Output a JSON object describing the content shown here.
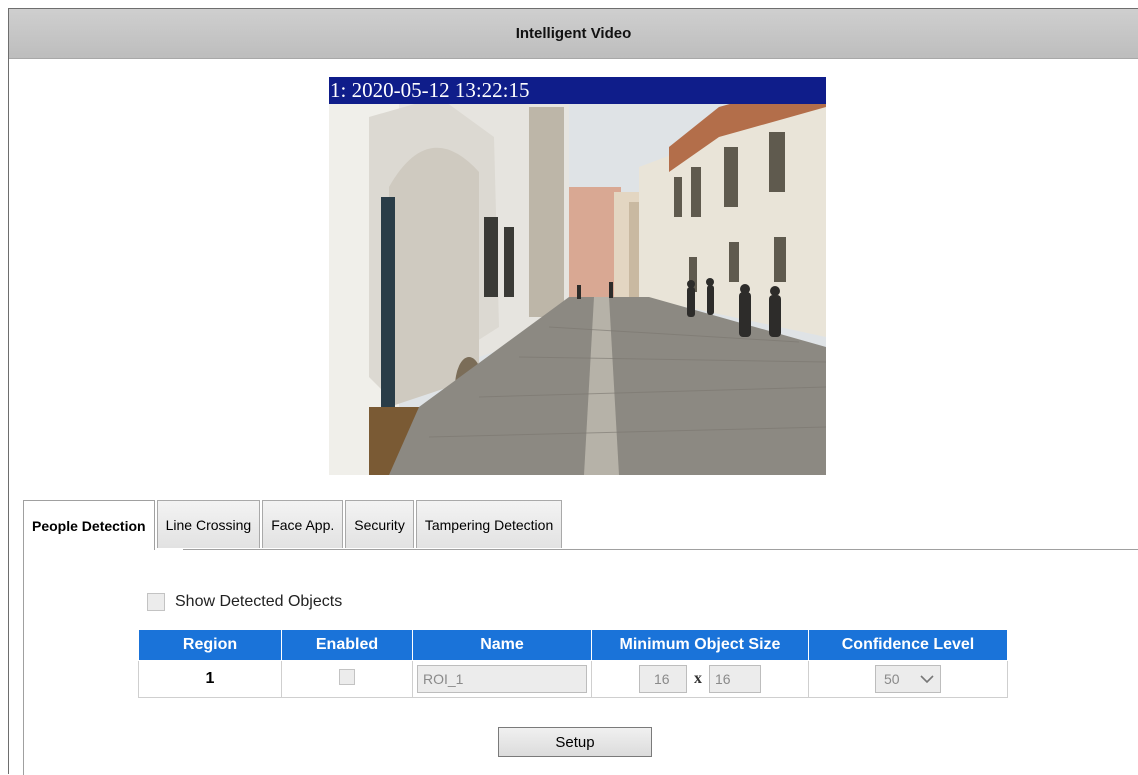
{
  "window": {
    "title": "Intelligent Video"
  },
  "video": {
    "timestamp": "1: 2020-05-12 13:22:15"
  },
  "tabs": [
    {
      "label": "People Detection",
      "active": true
    },
    {
      "label": "Line Crossing",
      "active": false
    },
    {
      "label": "Face App.",
      "active": false
    },
    {
      "label": "Security",
      "active": false
    },
    {
      "label": "Tampering Detection",
      "active": false
    }
  ],
  "people_detection": {
    "show_detected_objects_label": "Show Detected Objects",
    "show_detected_objects_checked": false,
    "table": {
      "headers": [
        "Region",
        "Enabled",
        "Name",
        "Minimum Object Size",
        "Confidence Level"
      ],
      "rows": [
        {
          "region": "1",
          "enabled": false,
          "name": "ROI_1",
          "min_w": "16",
          "x": "x",
          "min_h": "16",
          "confidence": "50"
        }
      ]
    },
    "setup_label": "Setup"
  },
  "colors": {
    "header_blue": "#1a73d9",
    "timestamp_bar": "#0f1d8a",
    "titlebar": "#c6c6c6"
  }
}
